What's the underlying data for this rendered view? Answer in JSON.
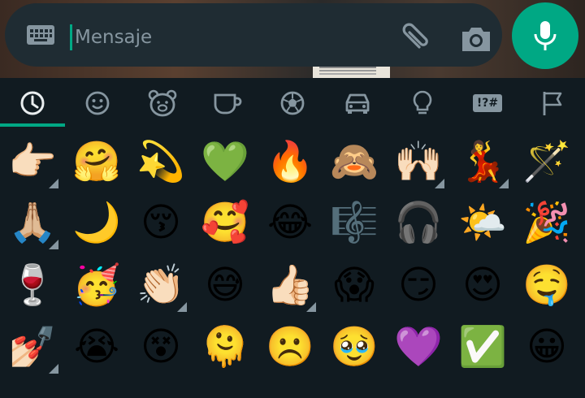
{
  "input": {
    "placeholder": "Mensaje"
  },
  "icons": {
    "keyboard": "keyboard-icon",
    "attach": "paperclip-icon",
    "camera": "camera-icon",
    "mic": "microphone-icon"
  },
  "colors": {
    "accent": "#00a884",
    "background": "#111b21",
    "bar": "#1f2c33",
    "icon": "#8696a0"
  },
  "categories": [
    {
      "name": "recent",
      "icon": "clock-icon",
      "active": true
    },
    {
      "name": "smileys",
      "icon": "smiley-icon",
      "active": false
    },
    {
      "name": "animals",
      "icon": "bear-icon",
      "active": false
    },
    {
      "name": "food",
      "icon": "cup-icon",
      "active": false
    },
    {
      "name": "activities",
      "icon": "ball-icon",
      "active": false
    },
    {
      "name": "travel",
      "icon": "car-icon",
      "active": false
    },
    {
      "name": "objects",
      "icon": "lightbulb-icon",
      "active": false
    },
    {
      "name": "symbols",
      "icon": "symbols-icon",
      "label": "!?#",
      "active": false
    },
    {
      "name": "flags",
      "icon": "flag-icon",
      "active": false
    }
  ],
  "emoji_rows": [
    [
      {
        "e": "👉🏻",
        "tone": true
      },
      {
        "e": "🤗",
        "tone": false
      },
      {
        "e": "💫",
        "tone": false
      },
      {
        "e": "💚",
        "tone": false
      },
      {
        "e": "🔥",
        "tone": false
      },
      {
        "e": "🙈",
        "tone": false
      },
      {
        "e": "🙌🏻",
        "tone": true
      },
      {
        "e": "💃",
        "tone": true
      },
      {
        "e": "🪄",
        "tone": false
      }
    ],
    [
      {
        "e": "🙏🏼",
        "tone": true
      },
      {
        "e": "🌙",
        "tone": false
      },
      {
        "e": "😚",
        "tone": false
      },
      {
        "e": "🥰",
        "tone": false
      },
      {
        "e": "😂",
        "tone": false
      },
      {
        "e": "🎼",
        "tone": false
      },
      {
        "e": "🎧",
        "tone": false
      },
      {
        "e": "🌤️",
        "tone": false
      },
      {
        "e": "🎉",
        "tone": false
      }
    ],
    [
      {
        "e": "🍷",
        "tone": false
      },
      {
        "e": "🥳",
        "tone": false
      },
      {
        "e": "👏🏻",
        "tone": true
      },
      {
        "e": "😅",
        "tone": false
      },
      {
        "e": "👍🏻",
        "tone": true
      },
      {
        "e": "😱",
        "tone": false
      },
      {
        "e": "😏",
        "tone": false
      },
      {
        "e": "😍",
        "tone": false
      },
      {
        "e": "🤤",
        "tone": false
      }
    ],
    [
      {
        "e": "💅🏻",
        "tone": true
      },
      {
        "e": "😭",
        "tone": false
      },
      {
        "e": "😵",
        "tone": false
      },
      {
        "e": "🫠",
        "tone": false
      },
      {
        "e": "☹️",
        "tone": false
      },
      {
        "e": "🥹",
        "tone": false
      },
      {
        "e": "💜",
        "tone": false
      },
      {
        "e": "✅",
        "tone": false
      },
      {
        "e": "😀",
        "tone": false
      }
    ]
  ]
}
